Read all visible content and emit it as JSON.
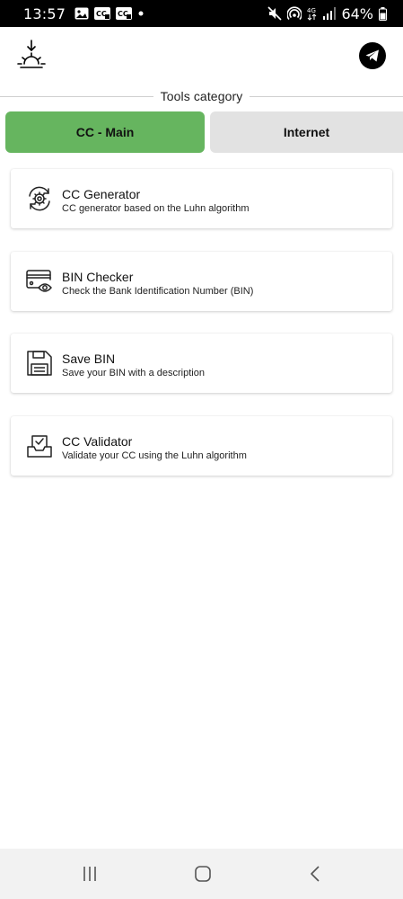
{
  "status_bar": {
    "time": "13:57",
    "left_icons": [
      "gallery-icon",
      "cc-notification-icon",
      "cc-notification-icon",
      "dot-icon"
    ],
    "right_icons": [
      "mute-icon",
      "hotspot-icon",
      "4g-icon",
      "signal-icon"
    ],
    "battery_text": "64%"
  },
  "header": {
    "logo_icon": "sunrise-logo-icon",
    "telegram_icon": "telegram-icon"
  },
  "category": {
    "title": "Tools category"
  },
  "tabs": [
    {
      "label": "CC - Main",
      "active": true
    },
    {
      "label": "Internet",
      "active": false
    }
  ],
  "tools": [
    {
      "title": "CC Generator",
      "description": "CC generator based on the Luhn algorithm",
      "icon": "gear-refresh-icon"
    },
    {
      "title": "BIN Checker",
      "description": "Check the Bank Identification Number (BIN)",
      "icon": "card-eye-icon"
    },
    {
      "title": "Save BIN",
      "description": "Save your BIN with a description",
      "icon": "floppy-disk-icon"
    },
    {
      "title": "CC Validator",
      "description": "Validate your CC using the Luhn algorithm",
      "icon": "tray-check-icon"
    }
  ],
  "nav": {
    "recents_icon": "recents-icon",
    "home_icon": "home-icon",
    "back_icon": "back-icon"
  },
  "colors": {
    "active_tab": "#66b55f",
    "inactive_tab": "#e2e2e2",
    "status_bar": "#000000",
    "nav_bar": "#f2f2f2"
  }
}
